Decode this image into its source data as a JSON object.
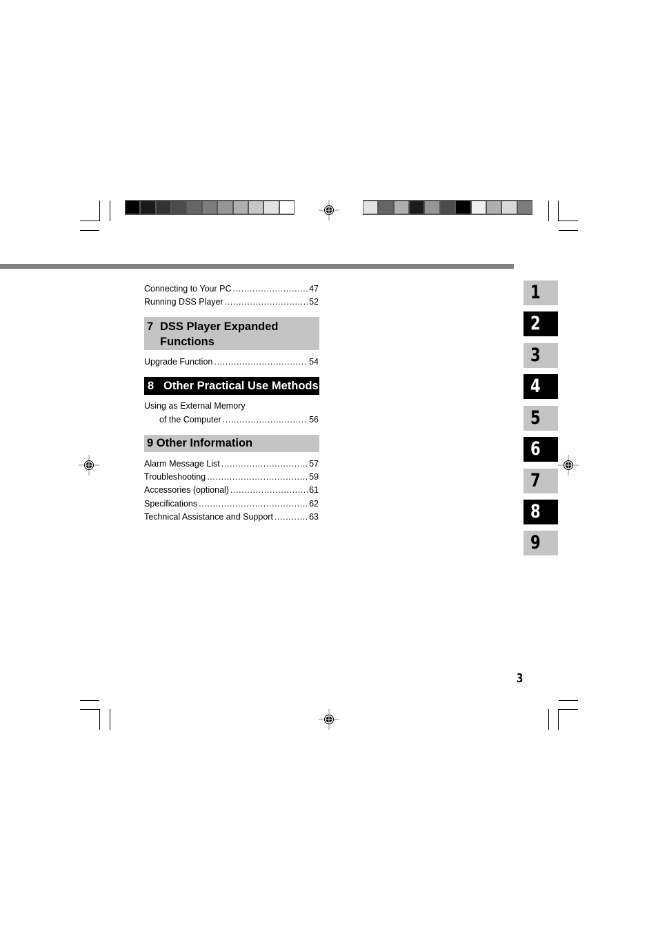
{
  "colorbars": {
    "left": [
      "#000000",
      "#1b1b1b",
      "#333333",
      "#4b4b4b",
      "#656565",
      "#7d7d7d",
      "#969696",
      "#afafaf",
      "#c8c8c8",
      "#e3e3e3",
      "#ffffff"
    ],
    "right": [
      "#e3e3e3",
      "#656565",
      "#afafaf",
      "#1b1b1b",
      "#969696",
      "#4b4b4b",
      "#000000",
      "#f0f0f0",
      "#afafaf",
      "#d8d8d8",
      "#7d7d7d"
    ]
  },
  "toc": {
    "top_entries": [
      {
        "title": "Connecting to Your PC",
        "page": "47"
      },
      {
        "title": "Running DSS Player",
        "page": "52"
      }
    ],
    "sections": [
      {
        "number": "7",
        "title_line1": "DSS Player Expanded",
        "title_line2": "Functions",
        "style": "gray",
        "entries": [
          {
            "title": "Upgrade Function",
            "page": "54"
          }
        ]
      },
      {
        "number": "8",
        "title": "Other Practical Use Methods",
        "style": "black",
        "entries": [
          {
            "title_line1": "Using as External Memory",
            "title_line2": "of the Computer",
            "page": "56"
          }
        ]
      },
      {
        "number": "9",
        "title": "Other Information",
        "style": "gray",
        "entries": [
          {
            "title": "Alarm Message List",
            "page": "57"
          },
          {
            "title": "Troubleshooting",
            "page": "59"
          },
          {
            "title": "Accessories (optional)",
            "page": "61"
          },
          {
            "title": "Specifications",
            "page": "62"
          },
          {
            "title": "Technical Assistance and Support",
            "page": "63"
          }
        ]
      }
    ]
  },
  "chapter_tabs": [
    {
      "label": "1",
      "style": "gray"
    },
    {
      "label": "2",
      "style": "black"
    },
    {
      "label": "3",
      "style": "gray"
    },
    {
      "label": "4",
      "style": "black"
    },
    {
      "label": "5",
      "style": "gray"
    },
    {
      "label": "6",
      "style": "black"
    },
    {
      "label": "7",
      "style": "gray"
    },
    {
      "label": "8",
      "style": "black"
    },
    {
      "label": "9",
      "style": "gray"
    }
  ],
  "page_number": "3"
}
